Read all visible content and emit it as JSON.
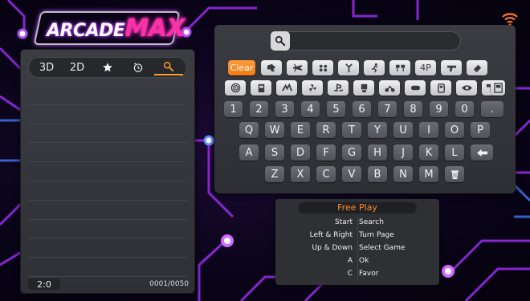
{
  "app": {
    "logo_main": "ARCADE",
    "logo_accent": "MAX"
  },
  "left_panel": {
    "tabs": [
      {
        "label": "3D",
        "type": "text"
      },
      {
        "label": "2D",
        "type": "text"
      },
      {
        "label": "",
        "type": "star-icon"
      },
      {
        "label": "",
        "type": "history-icon"
      },
      {
        "label": "",
        "type": "search-icon",
        "active": true
      }
    ],
    "status_left": "2:0",
    "status_right": "0001/0050"
  },
  "search": {
    "placeholder": ""
  },
  "keyboard": {
    "clear_label": "Clear",
    "genre_row1": [
      "fighting-icon",
      "shooter-icon",
      "puzzle-icon",
      "sports-icon",
      "action-icon",
      "racing-icon"
    ],
    "label_4p": "4P",
    "genre_row1_tail": [
      "gun-icon",
      "eraser-icon"
    ],
    "genre_row2": [
      "spiral-icon",
      "arcade-cabinet-icon",
      "bird-icon",
      "fan-icon",
      "playstation-icon",
      "mahjong-icon",
      "motorbike-icon",
      "console-icon",
      "handheld-icon",
      "eye-icon",
      "hammer-icon",
      "memory-card-icon"
    ],
    "numbers": [
      "1",
      "2",
      "3",
      "4",
      "5",
      "6",
      "7",
      "8",
      "9",
      "0",
      "."
    ],
    "row_q": [
      "Q",
      "W",
      "E",
      "R",
      "T",
      "Y",
      "U",
      "I",
      "O",
      "P"
    ],
    "row_a": [
      "A",
      "S",
      "D",
      "F",
      "G",
      "H",
      "J",
      "K",
      "L"
    ],
    "row_z": [
      "Z",
      "X",
      "C",
      "V",
      "B",
      "N",
      "M"
    ]
  },
  "help": {
    "title": "Free Play",
    "rows": [
      {
        "key": "Start",
        "value": "Search"
      },
      {
        "key": "Left & Right",
        "value": "Turn Page"
      },
      {
        "key": "Up & Down",
        "value": "Select Game"
      },
      {
        "key": "A",
        "value": "Ok"
      },
      {
        "key": "C",
        "value": "Favor"
      }
    ]
  },
  "colors": {
    "accent": "#ff9b2c",
    "logo_pink": "#ff2fa8",
    "neon_purple": "#a43bff",
    "wifi": "#ff7a1a"
  }
}
